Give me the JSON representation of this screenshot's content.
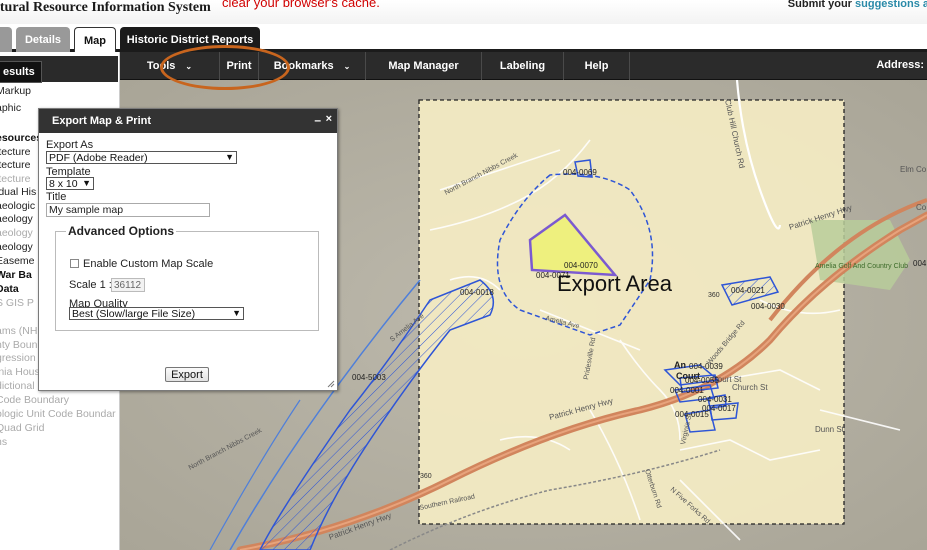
{
  "header": {
    "app_title": "ltural Resource Information System",
    "cache_note": "clear your browser's cache.",
    "submit_prefix": "Submit your ",
    "submit_link": "suggestions a"
  },
  "tabs": [
    {
      "label": ""
    },
    {
      "label": "Details"
    },
    {
      "label": "Map",
      "active": true
    },
    {
      "label": "Historic District Reports"
    }
  ],
  "left_panel": {
    "results_label": "esults",
    "layers": [
      {
        "label": "Markup",
        "style": "dark"
      },
      {
        "label": "aphic",
        "style": "dark"
      },
      {
        "label": "esources",
        "style": "bold"
      },
      {
        "label": "itecture",
        "style": "dark"
      },
      {
        "label": "itecture",
        "style": "dark"
      },
      {
        "label": "itecture",
        "style": "grey"
      },
      {
        "label": "idual His",
        "style": "dark"
      },
      {
        "label": "aeologic",
        "style": "dark"
      },
      {
        "label": "aeology",
        "style": "dark"
      },
      {
        "label": "aeology",
        "style": "grey"
      },
      {
        "label": "aeology",
        "style": "dark"
      },
      {
        "label": "Easeme",
        "style": "dark"
      },
      {
        "label": "War Ba",
        "style": "bold"
      },
      {
        "label": "Data",
        "style": "bold"
      },
      {
        "label": "S GIS P",
        "style": "grey"
      },
      {
        "label": "ams (NH",
        "style": "grey"
      },
      {
        "label": "nty Boun",
        "style": "grey"
      },
      {
        "label": "gression",
        "style": "grey"
      },
      {
        "label": "inia Hous",
        "style": "grey"
      },
      {
        "label": "dictional",
        "style": "grey"
      },
      {
        "label": "Code Boundary",
        "style": "grey"
      },
      {
        "label": "ologic Unit Code Boundar",
        "style": "grey"
      },
      {
        "label": "Quad Grid",
        "style": "grey"
      },
      {
        "label": "ns",
        "style": "grey"
      }
    ]
  },
  "toolbar": {
    "tools": "Tools",
    "print": "Print",
    "bookmarks": "Bookmarks",
    "map_manager": "Map Manager",
    "labeling": "Labeling",
    "help": "Help",
    "address": "Address:"
  },
  "dialog": {
    "title": "Export Map & Print",
    "minimize": "–",
    "close": "×",
    "export_as_label": "Export As",
    "export_as_value": "PDF (Adobe Reader)",
    "template_label": "Template",
    "template_value": "8 x 10",
    "title_label": "Title",
    "title_value": "My sample map",
    "advanced_legend": "Advanced Options",
    "custom_scale_label": "Enable Custom Map Scale",
    "custom_scale_checked": false,
    "scale_label": "Scale 1 :",
    "scale_value": "36112",
    "quality_label": "Map Quality",
    "quality_value": "Best (Slow/large File Size)",
    "export_button": "Export"
  },
  "map": {
    "export_area_label": "Export Area",
    "colors": {
      "road": "#d1855d",
      "export_area_fill": "#f4ecc3",
      "parcel_stroke": "#2e55d6",
      "selected_fill": "#eef07e",
      "selected_stroke": "#7b5ad0",
      "highlight": "#c8651e",
      "green_area": "#b8cc9a"
    },
    "road_labels": {
      "patrick_henry_hwy_1": "Patrick Henry Hwy",
      "patrick_henry_hwy_2": "Patrick Henry Hwy",
      "patrick_henry_hwy_3": "Patrick Henry Hwy",
      "club_hill_church_rd": "Club Hill Church Rd",
      "north_branch_nibbs_creek": "North Branch Nibbs Creek",
      "north_branch_nibbs_creek_2": "North Branch Nibbs Creek",
      "elm_cot": "Elm Co",
      "amelia_ave_1": "S Amelia Ave",
      "amelia_ave_2": "Amelia Ave",
      "pridesville_rd": "Pridesville Rd",
      "woods_bridge_rd": "Woods Bridge Rd",
      "church_st": "Church St",
      "court_st": "Court St",
      "dunn_st": "Dunn St",
      "virginia_st": "Virginia St",
      "otterburn_rd": "Otterburn Rd",
      "n_five_forks_rd": "N Five Forks Rd",
      "southern_railroad": "Southern Railroad",
      "amelia_golf": "Amelia Golf And Country Club",
      "route_360_1": "360",
      "route_360_2": "360",
      "an_label": "An",
      "court_label": "Court",
      "ct_label": "Co"
    },
    "parcels": {
      "p0069": "004-0069",
      "p0070": "004-0070",
      "p0071": "004-0071",
      "p0018": "004-0018",
      "p0021": "004-0021",
      "p0030": "004-0030",
      "p5003": "004-5003",
      "p0039": "004-0039",
      "p0055": "004-0055",
      "p0001": "004-0001",
      "p0031": "004-0031",
      "p0017": "004-0017",
      "p0015": "004-0015",
      "p004_far": "004"
    }
  }
}
